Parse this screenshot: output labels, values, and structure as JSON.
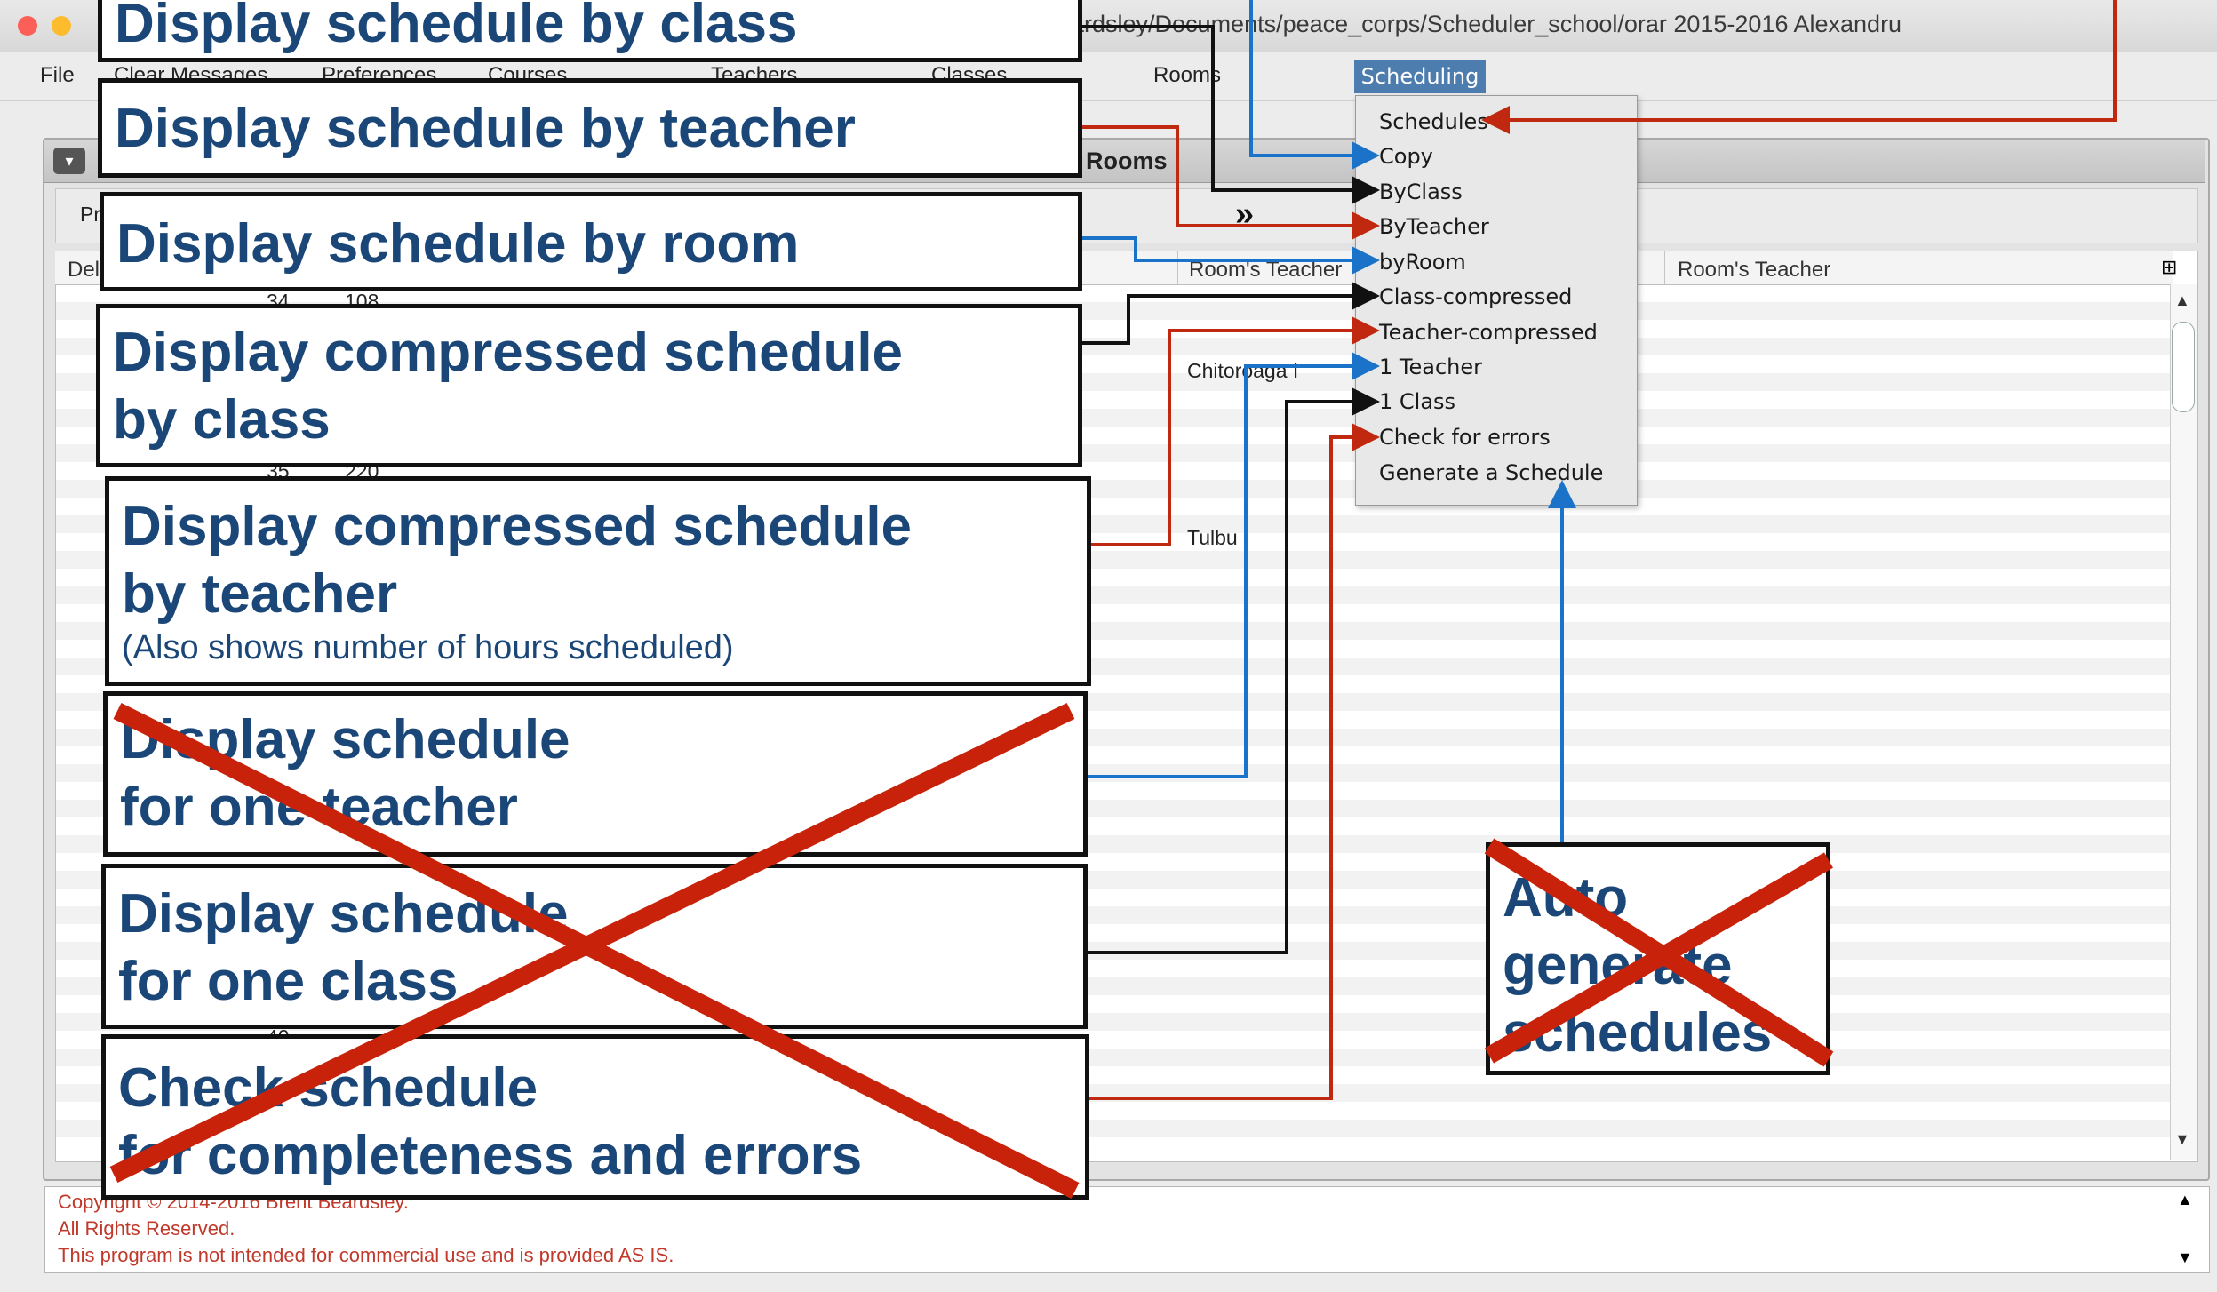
{
  "window": {
    "title": "ardsley/Documents/peace_corps/Scheduler_school/orar 2015-2016 Alexandru"
  },
  "menubar": {
    "file": "File",
    "clear_messages": "Clear Messages",
    "preferences": "Preferences",
    "courses": "Courses",
    "teachers": "Teachers",
    "classes": "Classes",
    "rooms": "Rooms",
    "scheduling": "Scheduling"
  },
  "frame": {
    "title": "Rooms",
    "toolbar_label": "Pr",
    "overflow_glyph": "»"
  },
  "table": {
    "headers": [
      "Del",
      "Room's Teacher",
      "Room's Teacher"
    ],
    "visible_cells": [
      "34",
      "108",
      "35",
      "220",
      "Chitoroaga I",
      "Tulbu",
      "40"
    ]
  },
  "scheduling_menu": {
    "items": [
      "Schedules",
      "Copy",
      "ByClass",
      "ByTeacher",
      "byRoom",
      "Class-compressed",
      "Teacher-compressed",
      "1 Teacher",
      "1 Class",
      "Check for errors",
      "Generate a Schedule"
    ]
  },
  "callouts": {
    "by_class": "Display schedule by class",
    "by_teacher": "Display schedule by teacher",
    "by_room": "Display schedule by room",
    "compressed_class_1": "Display compressed schedule",
    "compressed_class_2": "by class",
    "compressed_teacher_1": "Display compressed schedule",
    "compressed_teacher_2": "by teacher",
    "compressed_teacher_note": "(Also shows number of hours scheduled)",
    "one_teacher_1": "Display schedule",
    "one_teacher_2": "for one teacher",
    "one_class_1": "Display schedule",
    "one_class_2": "for one class",
    "check_1": "Check schedule",
    "check_2": "for completeness and errors",
    "auto_1": "Auto",
    "auto_2": "generate",
    "auto_3": "schedules"
  },
  "footer": {
    "line1": "Copyright © 2014-2016 Brent Beardsley.",
    "line2": "All Rights Reserved.",
    "line3": "This program is not intended for commercial use and is provided AS IS."
  },
  "colors": {
    "callout_text": "#1b4778",
    "arrow_red": "#c0280f",
    "arrow_blue": "#1a73c9",
    "arrow_black": "#111111",
    "strike_red": "#c8230a",
    "menu_highlight": "#4d7caf",
    "footer_text": "#c0392b"
  }
}
